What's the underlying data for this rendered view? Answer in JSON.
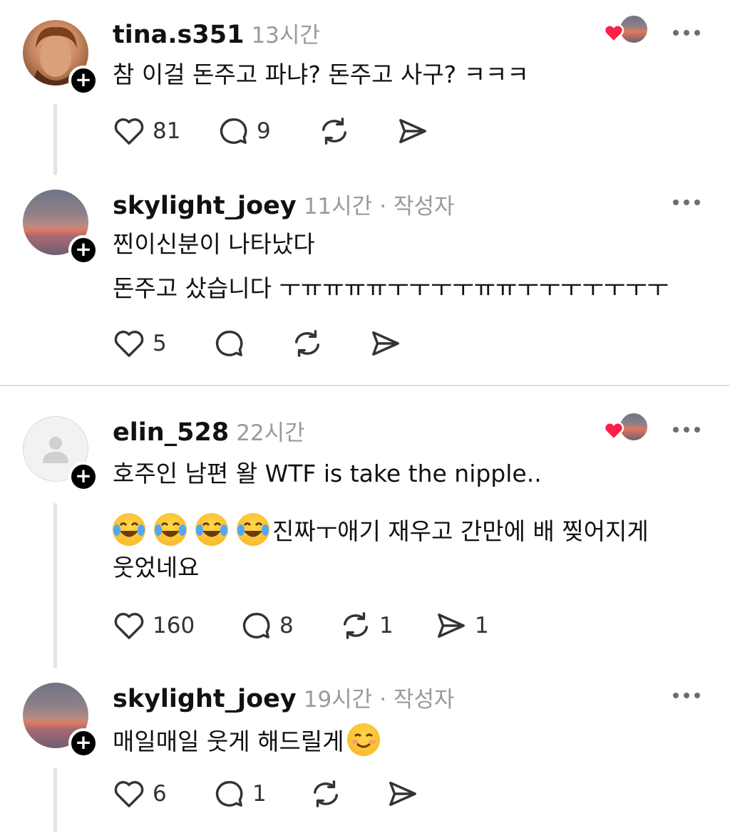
{
  "posts": [
    {
      "username": "tina.s351",
      "time": "13시간",
      "author_tag": "",
      "text": "참 이걸 돈주고 파냐? 돈주고 사구? ㅋㅋㅋ",
      "likes": "81",
      "comments": "9",
      "reposts": "",
      "shares": ""
    },
    {
      "username": "skylight_joey",
      "time": "11시간",
      "author_tag": "· 작성자",
      "text": "찐이신분이 나타났다\n돈주고 샀습니다 ㅜㅠㅠㅠㅠㅜㅜㅜㅜㅠㅠㅜㅜㅜㅜㅜㅜㅜ",
      "likes": "5",
      "comments": "",
      "reposts": "",
      "shares": ""
    },
    {
      "username": "elin_528",
      "time": "22시간",
      "author_tag": "",
      "text": "호주인 남편 왈 WTF is take the nipple..",
      "text2": "진짜ㅜ애기 재우고 간만에 배 찢어지게",
      "text3": "웃었네요",
      "likes": "160",
      "comments": "8",
      "reposts": "1",
      "shares": "1"
    },
    {
      "username": "skylight_joey",
      "time": "19시간",
      "author_tag": "· 작성자",
      "text": "매일매일 웃게 해드릴게",
      "likes": "6",
      "comments": "1",
      "reposts": "",
      "shares": ""
    }
  ],
  "icons": {
    "like": "heart-outline-icon",
    "comment": "speech-bubble-icon",
    "repost": "repost-arrows-icon",
    "share": "paper-plane-icon",
    "more": "ellipsis-icon",
    "follow": "plus-icon",
    "liked_by_author": "red-heart-icon"
  },
  "colors": {
    "heart_red": "#ff1f47",
    "meta_gray": "#9a9a9a",
    "thread_line": "#e3e3e3"
  }
}
